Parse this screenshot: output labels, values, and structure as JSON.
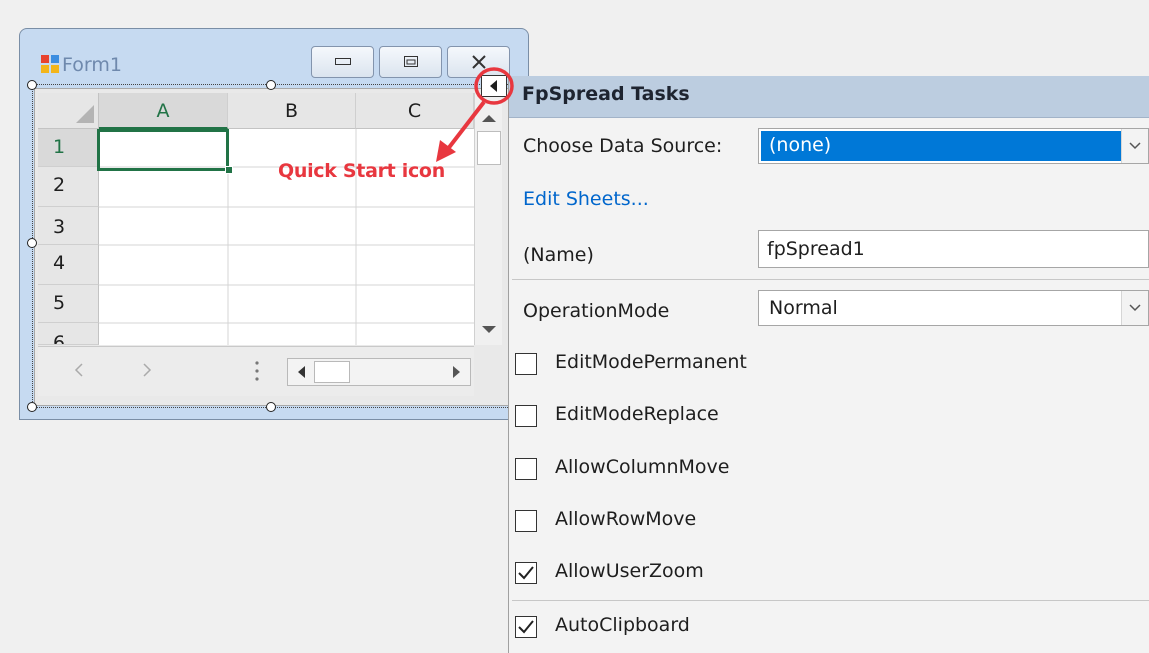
{
  "form": {
    "title": "Form1",
    "icon": "form-icon"
  },
  "grid": {
    "columns": [
      "A",
      "B",
      "C"
    ],
    "rows": [
      "1",
      "2",
      "3",
      "4",
      "5",
      "6"
    ],
    "active_cell": "A1"
  },
  "annotation": {
    "text": "Quick Start icon",
    "color": "#e8373f"
  },
  "tasks": {
    "title": "FpSpread Tasks",
    "data_source_label": "Choose Data Source:",
    "data_source_value": "(none)",
    "edit_sheets_link": "Edit Sheets...",
    "name_label": "(Name)",
    "name_value": "fpSpread1",
    "operation_mode_label": "OperationMode",
    "operation_mode_value": "Normal",
    "checkboxes": [
      {
        "label": "EditModePermanent",
        "checked": false
      },
      {
        "label": "EditModeReplace",
        "checked": false
      },
      {
        "label": "AllowColumnMove",
        "checked": false
      },
      {
        "label": "AllowRowMove",
        "checked": false
      },
      {
        "label": "AllowUserZoom",
        "checked": true
      },
      {
        "label": "AutoClipboard",
        "checked": true
      }
    ]
  },
  "colors": {
    "selection": "#0078d7",
    "link": "#0066cc",
    "active_border": "#217346"
  }
}
